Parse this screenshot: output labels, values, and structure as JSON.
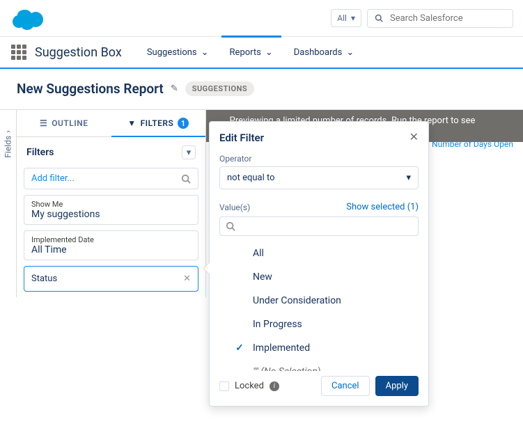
{
  "topbar": {
    "scope": "All",
    "search_placeholder": "Search Salesforce"
  },
  "nav": {
    "app": "Suggestion Box",
    "items": [
      "Suggestions",
      "Reports",
      "Dashboards"
    ],
    "active": 1
  },
  "page": {
    "title": "New Suggestions Report",
    "tag": "SUGGESTIONS"
  },
  "rail": {
    "label": "Fields"
  },
  "tabs": {
    "outline": "OUTLINE",
    "filters": "FILTERS",
    "count": "1"
  },
  "filters": {
    "heading": "Filters",
    "add_placeholder": "Add filter...",
    "items": [
      {
        "label": "Show Me",
        "value": "My suggestions"
      },
      {
        "label": "Implemented Date",
        "value": "All Time"
      }
    ],
    "status_label": "Status"
  },
  "infobar": "Previewing a limited number of records. Run the report to see everything.",
  "column": "Number of Days Open",
  "editFilter": {
    "title": "Edit Filter",
    "operator_label": "Operator",
    "operator_value": "not equal to",
    "values_label": "Value(s)",
    "show_selected": "Show selected (1)",
    "options": [
      "All",
      "New",
      "Under Consideration",
      "In Progress",
      "Implemented",
      "\"\" (No Selection)"
    ],
    "selected_index": 4,
    "locked": "Locked",
    "cancel": "Cancel",
    "apply": "Apply"
  }
}
